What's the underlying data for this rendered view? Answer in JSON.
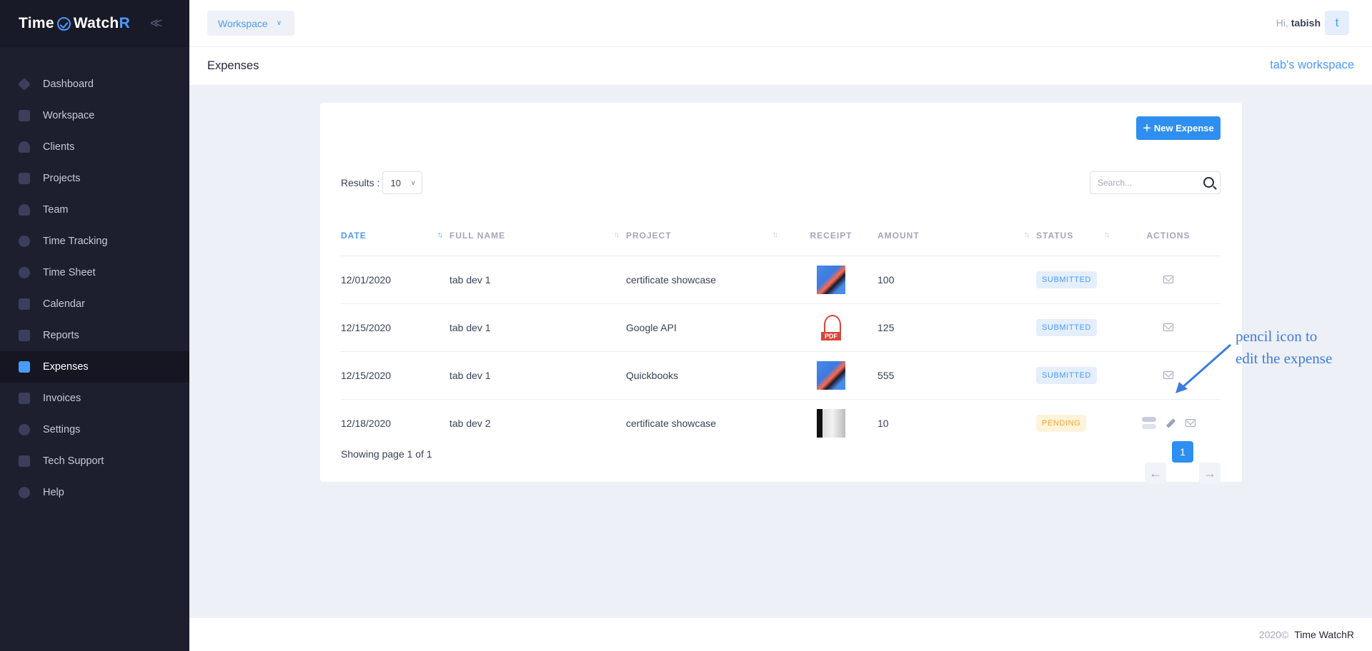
{
  "brand": {
    "part1": "Time",
    "part2": "Watch",
    "part3": "R"
  },
  "sidebar": {
    "items": [
      {
        "label": "Dashboard",
        "icon": "dashboard-icon"
      },
      {
        "label": "Workspace",
        "icon": "building-icon"
      },
      {
        "label": "Clients",
        "icon": "user-icon"
      },
      {
        "label": "Projects",
        "icon": "monitor-icon"
      },
      {
        "label": "Team",
        "icon": "team-icon"
      },
      {
        "label": "Time Tracking",
        "icon": "stopwatch-icon"
      },
      {
        "label": "Time Sheet",
        "icon": "clock-icon"
      },
      {
        "label": "Calendar",
        "icon": "calendar-icon"
      },
      {
        "label": "Reports",
        "icon": "report-icon"
      },
      {
        "label": "Expenses",
        "icon": "money-icon",
        "active": true
      },
      {
        "label": "Invoices",
        "icon": "invoice-icon"
      },
      {
        "label": "Settings",
        "icon": "gear-icon"
      },
      {
        "label": "Tech Support",
        "icon": "support-icon"
      },
      {
        "label": "Help",
        "icon": "help-icon"
      }
    ]
  },
  "topbar": {
    "workspace_label": "Workspace",
    "greeting": "Hi,",
    "username": "tabish",
    "avatar_letter": "t"
  },
  "subheader": {
    "title": "Expenses",
    "workspace_name": "tab's workspace"
  },
  "card": {
    "new_button_label": "New Expense",
    "results_label": "Results :",
    "results_value": "10",
    "search_placeholder": "Search..."
  },
  "table": {
    "headers": [
      "DATE",
      "FULL NAME",
      "PROJECT",
      "RECEIPT",
      "AMOUNT",
      "STATUS",
      "ACTIONS"
    ],
    "rows": [
      {
        "date": "12/01/2020",
        "name": "tab dev 1",
        "project": "certificate showcase",
        "receipt": "image",
        "amount": "100",
        "status": "SUBMITTED"
      },
      {
        "date": "12/15/2020",
        "name": "tab dev 1",
        "project": "Google API",
        "receipt": "pdf",
        "amount": "125",
        "status": "SUBMITTED"
      },
      {
        "date": "12/15/2020",
        "name": "tab dev 1",
        "project": "Quickbooks",
        "receipt": "image",
        "amount": "555",
        "status": "SUBMITTED"
      },
      {
        "date": "12/18/2020",
        "name": "tab dev 2",
        "project": "certificate showcase",
        "receipt": "document",
        "amount": "10",
        "status": "PENDING"
      }
    ],
    "pdf_label": "PDF"
  },
  "pagination": {
    "showing_text": "Showing page 1 of 1",
    "current_page": "1"
  },
  "annotation": {
    "line1": "pencil icon to",
    "line2": "edit the expense"
  },
  "footer": {
    "year": "2020©",
    "brand": "Time WatchR"
  },
  "colors": {
    "accent": "#4a9bff",
    "sidebar_bg": "#1e1f2e",
    "pending": "#f6a623",
    "annotation": "#3c7ce0"
  }
}
